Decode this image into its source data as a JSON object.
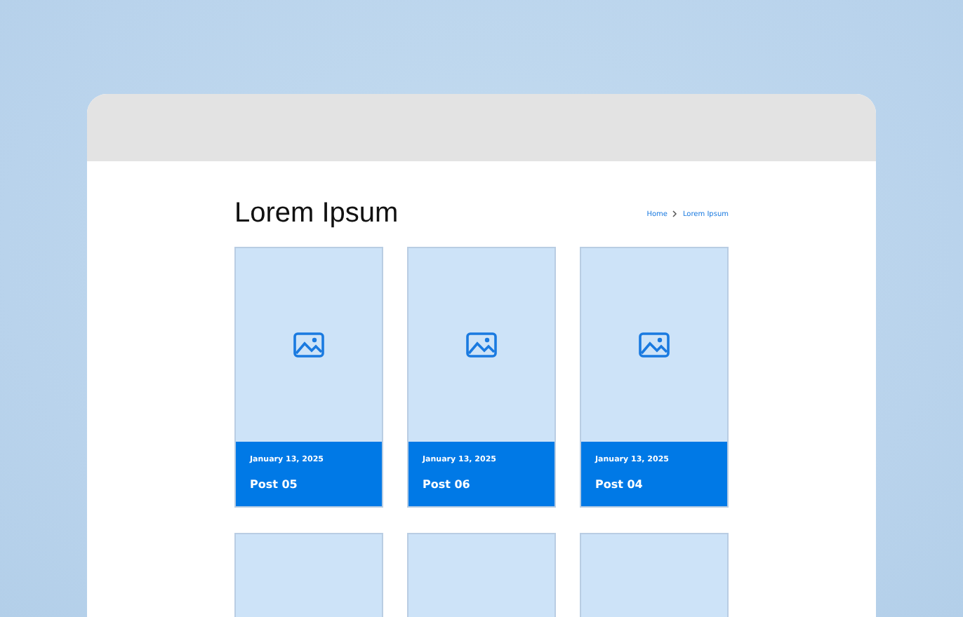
{
  "page": {
    "title": "Lorem Ipsum"
  },
  "breadcrumb": [
    {
      "label": "Home"
    },
    {
      "label": "Lorem Ipsum"
    }
  ],
  "posts": [
    {
      "kind": "full",
      "date": "January 13, 2025",
      "title": "Post 05"
    },
    {
      "kind": "full",
      "date": "January 13, 2025",
      "title": "Post 06"
    },
    {
      "kind": "full",
      "date": "January 13, 2025",
      "title": "Post 04"
    },
    {
      "kind": "image_only"
    },
    {
      "kind": "image_only"
    },
    {
      "kind": "image_only"
    }
  ]
}
